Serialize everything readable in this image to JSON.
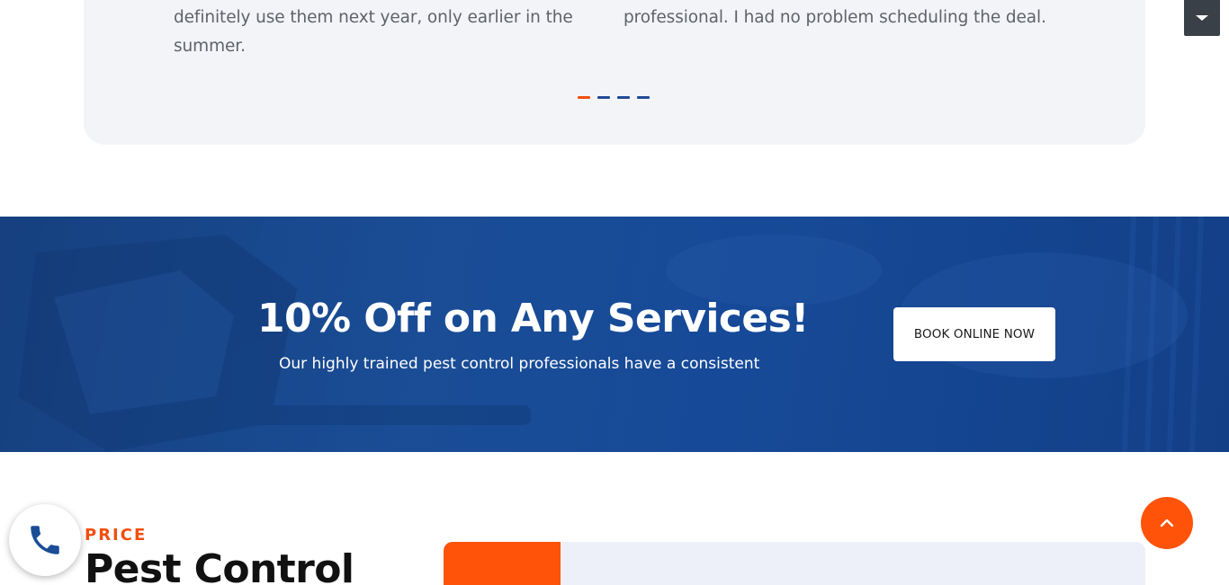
{
  "testimonials": {
    "left_quote": "definitely use them next year, only earlier in the summer.",
    "right_quote": "professional. I had no problem scheduling the deal.",
    "pagination": {
      "total": 4,
      "active": 1
    }
  },
  "top_dropdown": {
    "icon": "caret-down-icon"
  },
  "promo_banner": {
    "title": "10% Off on Any Services!",
    "subtitle": "Our highly trained pest control professionals have a consistent",
    "cta_label": "BOOK ONLINE NOW"
  },
  "pricing": {
    "eyebrow": "PRICE",
    "heading": "Pest Control"
  },
  "floating": {
    "scroll_top_icon": "chevron-up-icon",
    "phone_icon": "phone-icon"
  },
  "colors": {
    "accent": "#ff5309",
    "brand_blue": "#1a4d96",
    "card_bg": "#f3f4f8"
  }
}
